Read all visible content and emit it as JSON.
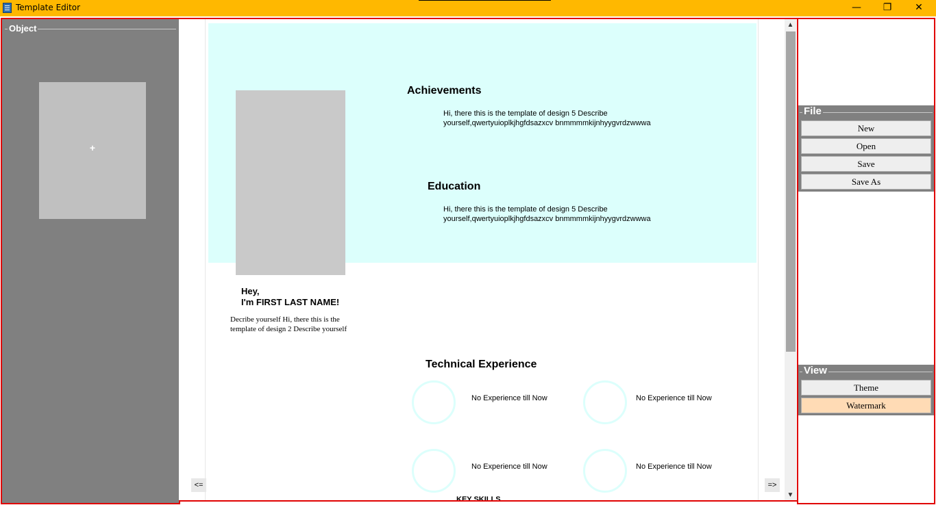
{
  "window": {
    "title": "Template Editor",
    "controls": {
      "minimize": "—",
      "maximize": "❐",
      "close": "✕"
    }
  },
  "object_panel": {
    "title": "Object",
    "add_label": "+"
  },
  "template": {
    "achievements": {
      "heading": "Achievements",
      "line1": "Hi, there this is the template of design 5 Describe",
      "line2": "yourself,qwertyuioplkjhgfdsazxcv bnmmmmkijnhyygvrdzwwwa"
    },
    "education": {
      "heading": "Education",
      "line1": "Hi, there this is the template of design 5 Describe",
      "line2": "yourself,qwertyuioplkjhgfdsazxcv bnmmmmkijnhyygvrdzwwwa"
    },
    "intro": {
      "hey": "Hey,",
      "name": "I'm FIRST LAST NAME!",
      "describe_line1": "Decribe yourself Hi, there this is the",
      "describe_line2": "template of design 2 Describe yourself"
    },
    "technical": {
      "heading": "Technical Experience",
      "items": [
        "No Experience till Now",
        "No Experience till Now",
        "No Experience till Now",
        "No Experience till Now"
      ]
    },
    "key_skills": "KEY SKILLS"
  },
  "navigation": {
    "prev": "<=",
    "next": "=>"
  },
  "scrollbar": {
    "up": "▲",
    "down": "▼"
  },
  "file_section": {
    "title": "File",
    "buttons": [
      "New",
      "Open",
      "Save",
      "Save As"
    ]
  },
  "view_section": {
    "title": "View",
    "buttons": [
      "Theme",
      "Watermark"
    ],
    "active": "Watermark"
  },
  "colors": {
    "titlebar": "#ffb800",
    "panel_border": "#e00000",
    "band": "#dcfffc",
    "active_button": "#ffdbb5"
  }
}
